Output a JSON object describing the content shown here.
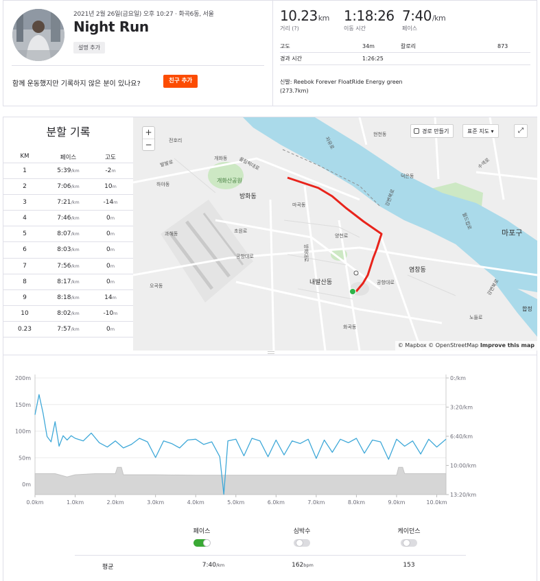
{
  "activity": {
    "datetime_location": "2021년 2월 26일(금요일) 오후 10:27 · 화곡6동, 서울",
    "title": "Night Run",
    "add_description": "설명 추가",
    "friend_question": "함께 운동했지만 기록하지 않은 분이 있나요?",
    "add_friend": "친구 추가"
  },
  "stats": {
    "distance": {
      "value": "10.23",
      "unit": "km",
      "label": "거리 (?)"
    },
    "moving_time": {
      "value": "1:18:26",
      "label": "이동 시간"
    },
    "pace": {
      "value": "7:40",
      "unit": "/km",
      "label": "페이스"
    },
    "elevation_label": "고도",
    "elevation_value": "34m",
    "calories_label": "칼로리",
    "calories_value": "873",
    "elapsed_label": "경과 시간",
    "elapsed_value": "1:26:25",
    "shoes": "신발: Reebok Forever FloatRide Energy green (273.7km)"
  },
  "splits": {
    "title": "분할 기록",
    "headers": [
      "KM",
      "페이스",
      "고도"
    ],
    "pace_unit": "/km",
    "elev_unit": "m",
    "rows": [
      {
        "km": "1",
        "pace": "5:39",
        "elev": "-2"
      },
      {
        "km": "2",
        "pace": "7:06",
        "elev": "10"
      },
      {
        "km": "3",
        "pace": "7:21",
        "elev": "-14"
      },
      {
        "km": "4",
        "pace": "7:46",
        "elev": "0"
      },
      {
        "km": "5",
        "pace": "8:07",
        "elev": "0"
      },
      {
        "km": "6",
        "pace": "8:03",
        "elev": "0"
      },
      {
        "km": "7",
        "pace": "7:56",
        "elev": "0"
      },
      {
        "km": "8",
        "pace": "8:17",
        "elev": "0"
      },
      {
        "km": "9",
        "pace": "8:18",
        "elev": "14"
      },
      {
        "km": "10",
        "pace": "8:02",
        "elev": "-10"
      },
      {
        "km": "0.23",
        "pace": "7:57",
        "elev": "0"
      }
    ]
  },
  "map": {
    "zoom_in": "+",
    "zoom_out": "−",
    "route_button": "경로 만들기",
    "style_select": "표준 지도 ▾",
    "fullscreen": "⤢",
    "attribution_mapbox": "© Mapbox",
    "attribution_osm": "© OpenStreetMap",
    "attribution_improve": "Improve this map",
    "labels": [
      "전호리",
      "개화동",
      "행주대교",
      "현천동",
      "상암동",
      "발발로",
      "하야동",
      "개화산공원",
      "방화동",
      "마곡동",
      "덕은동",
      "수색로",
      "월드컵로",
      "마포구",
      "과해동",
      "초원로",
      "양천로",
      "공항대로",
      "염창동",
      "내발산동",
      "화곡로",
      "오곡동",
      "화곡동",
      "공항대로",
      "노들로",
      "합정",
      "강변북로",
      "한강",
      "방화대로",
      "올림픽대로",
      "자유로"
    ]
  },
  "chart_data": {
    "type": "line",
    "x_unit": "km",
    "x_ticks": [
      "0.0km",
      "1.0km",
      "2.0km",
      "3.0km",
      "4.0km",
      "5.0km",
      "6.0km",
      "7.0km",
      "8.0km",
      "9.0km",
      "10.0km"
    ],
    "xlim": [
      0,
      10.23
    ],
    "y_left_ticks": [
      "200m",
      "150m",
      "100m",
      "50m",
      "0m"
    ],
    "y_left_range": [
      0,
      200
    ],
    "y_right_ticks": [
      "0:/km",
      "3:20/km",
      "6:40/km",
      "10:00/km",
      "13:20/km"
    ],
    "series": [
      {
        "name": "페이스",
        "type": "line",
        "color": "#3ea8d8",
        "axis": "right",
        "x": [
          0.0,
          0.1,
          0.2,
          0.3,
          0.4,
          0.5,
          0.6,
          0.7,
          0.8,
          0.9,
          1.0,
          1.2,
          1.4,
          1.6,
          1.8,
          2.0,
          2.2,
          2.4,
          2.6,
          2.8,
          3.0,
          3.2,
          3.4,
          3.6,
          3.8,
          4.0,
          4.2,
          4.4,
          4.6,
          4.7,
          4.8,
          5.0,
          5.2,
          5.4,
          5.6,
          5.8,
          6.0,
          6.2,
          6.4,
          6.6,
          6.8,
          7.0,
          7.2,
          7.4,
          7.6,
          7.8,
          8.0,
          8.2,
          8.4,
          8.6,
          8.8,
          9.0,
          9.2,
          9.4,
          9.6,
          9.8,
          10.0,
          10.23
        ],
        "y_pace_min_per_km": [
          4.2,
          1.9,
          4.0,
          6.7,
          7.3,
          5.0,
          7.8,
          6.6,
          7.1,
          6.6,
          6.9,
          7.2,
          6.3,
          7.4,
          7.9,
          7.2,
          8.0,
          7.6,
          6.9,
          7.3,
          9.1,
          7.2,
          7.5,
          8.0,
          7.1,
          7.0,
          7.6,
          7.3,
          9.0,
          13.3,
          7.2,
          7.0,
          8.9,
          6.9,
          7.2,
          9.0,
          7.1,
          8.8,
          7.2,
          7.5,
          7.0,
          9.2,
          7.1,
          8.5,
          7.0,
          7.4,
          6.9,
          8.6,
          7.1,
          7.3,
          9.3,
          7.0,
          7.8,
          7.2,
          8.7,
          7.0,
          7.9,
          7.0
        ]
      },
      {
        "name": "고도",
        "type": "area",
        "color": "#d6d6d6",
        "axis": "left",
        "x": [
          0.0,
          0.5,
          0.8,
          1.0,
          1.5,
          2.0,
          2.05,
          2.15,
          2.2,
          3.0,
          4.0,
          5.0,
          6.0,
          7.0,
          8.0,
          9.0,
          9.05,
          9.15,
          9.2,
          10.0,
          10.23
        ],
        "y_elevation_m": [
          20,
          20,
          14,
          18,
          20,
          20,
          32,
          32,
          18,
          18,
          17,
          17,
          17,
          17,
          17,
          17,
          32,
          32,
          20,
          20,
          20
        ]
      }
    ],
    "legend": {
      "items": [
        {
          "label": "페이스",
          "enabled": true
        },
        {
          "label": "심박수",
          "enabled": false
        },
        {
          "label": "케이던스",
          "enabled": false
        }
      ],
      "average_label": "평균",
      "average_pace": "7:40",
      "average_pace_unit": "/km",
      "average_hr": "162",
      "average_hr_unit": "bpm",
      "average_cadence": "153"
    }
  }
}
